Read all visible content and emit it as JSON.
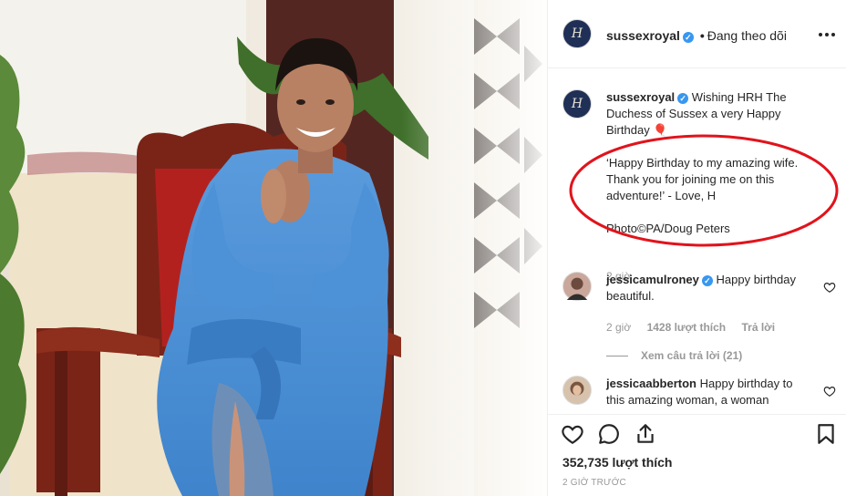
{
  "post": {
    "username": "sussexroyal",
    "separator": "•",
    "follow_label": "Đang theo dõi",
    "avatar_monogram": "H",
    "more_icon": "more-horizontal-icon",
    "image_alt": "Duchess of Sussex in a blue shirt dress smiling on a red carved chair"
  },
  "caption": {
    "username": "sussexroyal",
    "line1": "Wishing HRH The Duchess of Sussex a very Happy Birthday 🎈",
    "line2": "‘Happy Birthday to my amazing wife. Thank you for joining me on this adventure!’ - Love, H",
    "line3": "Photo©PA/Doug Peters",
    "time": "2 giờ"
  },
  "comments": [
    {
      "username": "jessicamulroney",
      "verified": true,
      "text": "Happy birthday beautiful.",
      "time": "2 giờ",
      "likes": "1428 lượt thích",
      "reply": "Trả lời",
      "view_replies": "Xem câu trả lời (21)"
    },
    {
      "username": "jessicaabberton",
      "verified": false,
      "text": "Happy birthday to this amazing woman, a woman"
    }
  ],
  "actions": {
    "likes": "352,735 lượt thích",
    "ago": "2 GIỜ TRƯỚC"
  },
  "colors": {
    "annotation_oval": "#e1131c",
    "verified": "#3897f0",
    "dress": "#4b8fd3"
  }
}
